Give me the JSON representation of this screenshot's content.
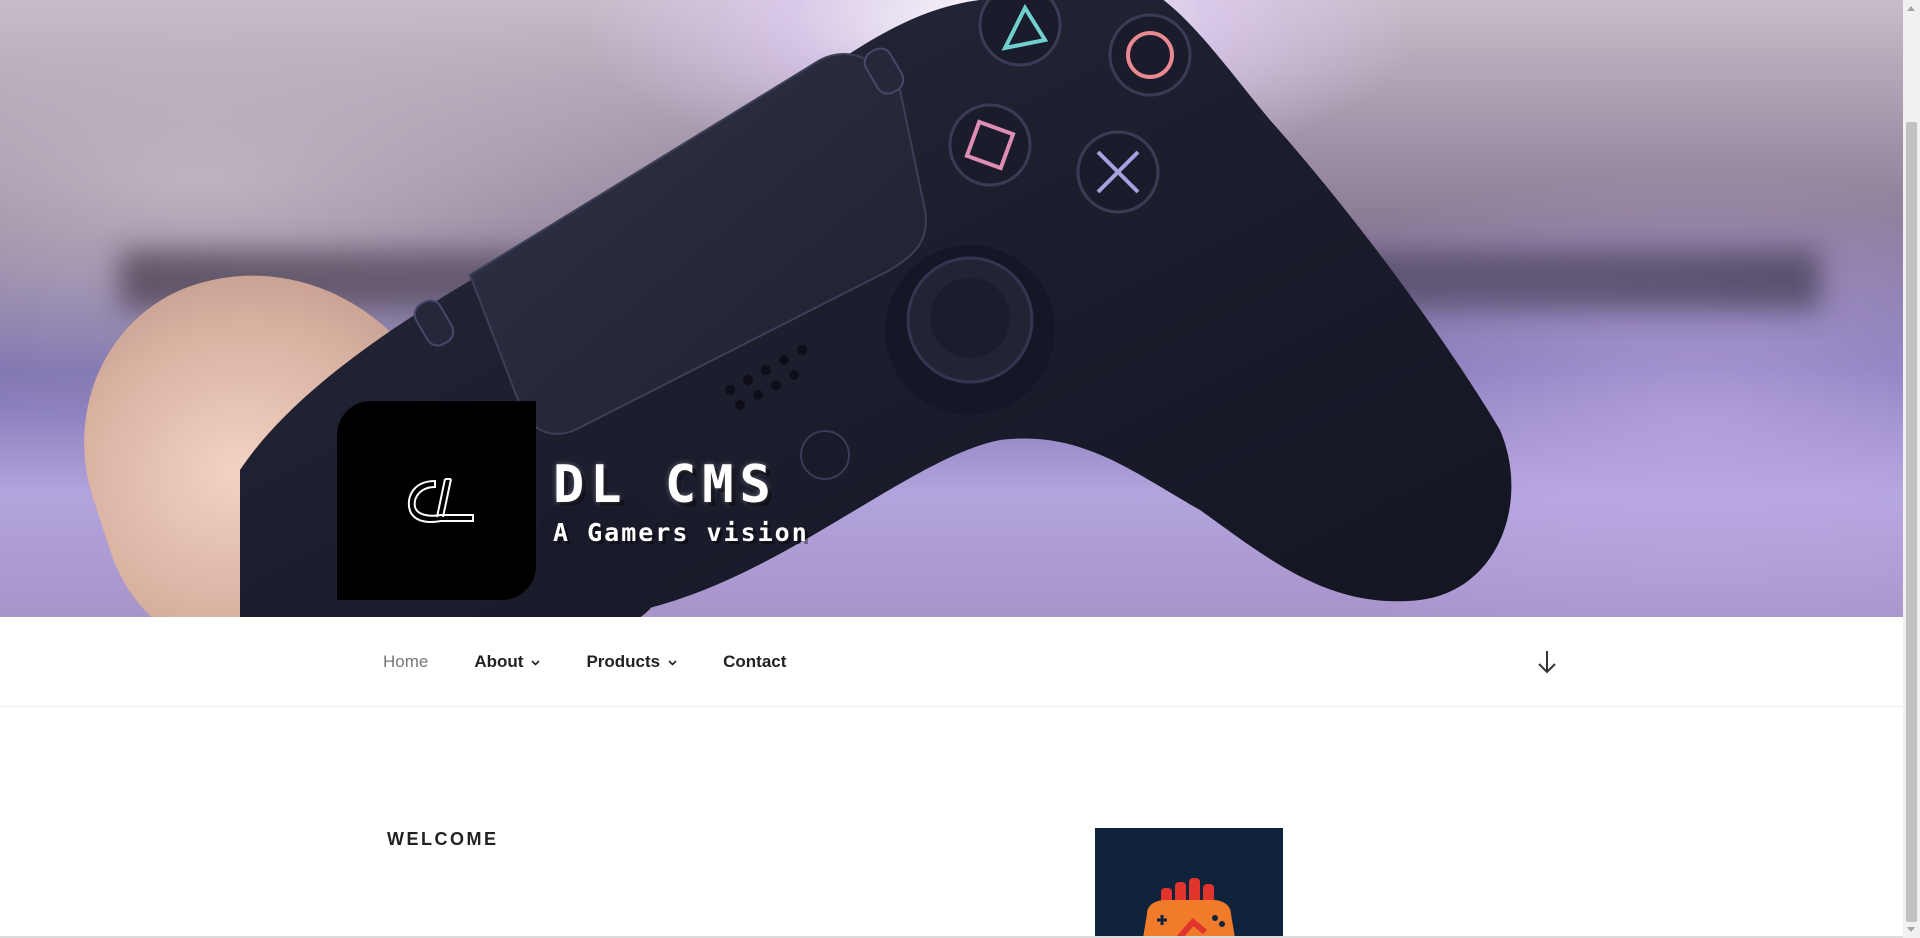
{
  "site": {
    "title": "DL CMS",
    "tagline": "A Gamers vision",
    "logo_text": "DL"
  },
  "nav": {
    "items": [
      {
        "label": "Home",
        "current": true,
        "has_submenu": false
      },
      {
        "label": "About",
        "current": false,
        "has_submenu": true
      },
      {
        "label": "Products",
        "current": false,
        "has_submenu": true
      },
      {
        "label": "Contact",
        "current": false,
        "has_submenu": false
      }
    ],
    "scroll_icon": "arrow-down-icon"
  },
  "content": {
    "section_title": "WELCOME",
    "feature_image_icon": "gamepad-fist-icon"
  },
  "colors": {
    "logo_bg": "#000000",
    "feature_bg": "#0f233c",
    "nav_current": "#767676",
    "nav_text": "#222222",
    "icon_orange": "#f07b2a",
    "icon_red": "#e0342c"
  }
}
